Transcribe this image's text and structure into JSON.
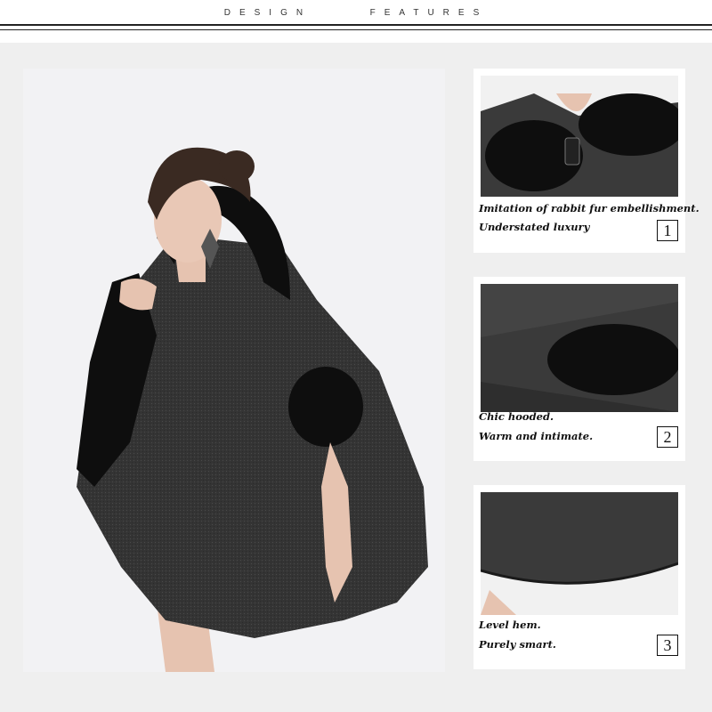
{
  "header": {
    "title_left": "DESIGN",
    "title_right": "FEATURES"
  },
  "main_image": {
    "alt": "model-wearing-hooded-cape"
  },
  "features": [
    {
      "caption_1": "Imitation of rabbit fur embellishment.",
      "caption_2": "Understated luxury",
      "number": "1"
    },
    {
      "caption_1": "Chic hooded.",
      "caption_2": "Warm and intimate.",
      "number": "2"
    },
    {
      "caption_1": "Level hem.",
      "caption_2": "Purely smart.",
      "number": "3"
    }
  ],
  "colors": {
    "background": "#efefef",
    "fabric": "#3a3a3a",
    "fur": "#0e0e0e"
  }
}
